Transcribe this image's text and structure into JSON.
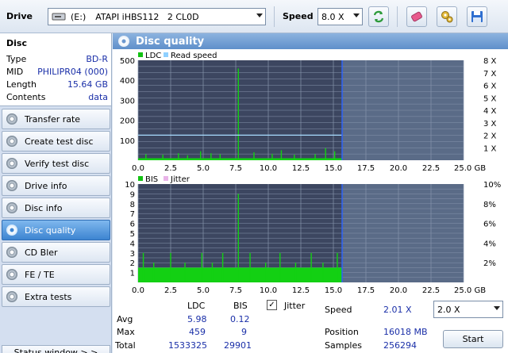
{
  "toolbar": {
    "drive_label": "Drive",
    "drive_letter": "(E:)",
    "drive_name": "ATAPI iHBS112   2 CL0D",
    "speed_label": "Speed",
    "speed_value": "8.0 X"
  },
  "disc": {
    "title": "Disc",
    "rows": [
      {
        "label": "Type",
        "value": "BD-R"
      },
      {
        "label": "MID",
        "value": "PHILIPR04 (000)"
      },
      {
        "label": "Length",
        "value": "15.64 GB"
      },
      {
        "label": "Contents",
        "value": "data"
      }
    ]
  },
  "nav": [
    {
      "label": "Transfer rate",
      "selected": false
    },
    {
      "label": "Create test disc",
      "selected": false
    },
    {
      "label": "Verify test disc",
      "selected": false
    },
    {
      "label": "Drive info",
      "selected": false
    },
    {
      "label": "Disc info",
      "selected": false
    },
    {
      "label": "Disc quality",
      "selected": true
    },
    {
      "label": "CD Bler",
      "selected": false
    },
    {
      "label": "FE / TE",
      "selected": false
    },
    {
      "label": "Extra tests",
      "selected": false
    }
  ],
  "status_window": "Status window > >",
  "panel_title": "Disc quality",
  "chart_data": [
    {
      "type": "bar",
      "legend": [
        "LDC",
        "Read speed"
      ],
      "x_ticks": [
        "0.0",
        "2.5",
        "5.0",
        "7.5",
        "10.0",
        "12.5",
        "15.0",
        "17.5",
        "20.0",
        "22.5",
        "25.0 GB"
      ],
      "xlim": [
        0,
        25
      ],
      "ylim": [
        0,
        500
      ],
      "y_ticks": [
        "100",
        "200",
        "300",
        "400",
        "500"
      ],
      "y2_ticks": [
        "1 X",
        "2 X",
        "3 X",
        "4 X",
        "5 X",
        "6 X",
        "7 X",
        "8 X"
      ],
      "y2lim": [
        0,
        8
      ],
      "data_end": 15.64,
      "ldc_base": 10,
      "ldc_spikes": [
        [
          0.6,
          30
        ],
        [
          1.9,
          28
        ],
        [
          3.1,
          35
        ],
        [
          3.8,
          25
        ],
        [
          4.8,
          45
        ],
        [
          5.6,
          35
        ],
        [
          6.3,
          30
        ],
        [
          7.7,
          459
        ],
        [
          8.9,
          40
        ],
        [
          10.3,
          32
        ],
        [
          11.0,
          50
        ],
        [
          12.0,
          28
        ],
        [
          13.6,
          30
        ],
        [
          14.4,
          60
        ],
        [
          15.1,
          45
        ]
      ],
      "read_speed_x": 2.01,
      "position_marker_gb": 15.64
    },
    {
      "type": "bar",
      "legend": [
        "BIS",
        "Jitter"
      ],
      "x_ticks": [
        "0.0",
        "2.5",
        "5.0",
        "7.5",
        "10.0",
        "12.5",
        "15.0",
        "17.5",
        "20.0",
        "22.5",
        "25.0 GB"
      ],
      "xlim": [
        0,
        25
      ],
      "ylim": [
        0,
        10
      ],
      "y_ticks": [
        "1",
        "2",
        "3",
        "4",
        "5",
        "6",
        "7",
        "8",
        "9",
        "10"
      ],
      "y2_ticks": [
        "2%",
        "4%",
        "6%",
        "8%",
        "10%"
      ],
      "y2lim": [
        0,
        10
      ],
      "data_end": 15.64,
      "bis_base": 1.5,
      "bis_spikes": [
        [
          0.4,
          3
        ],
        [
          1.2,
          2
        ],
        [
          2.5,
          3
        ],
        [
          3.6,
          2
        ],
        [
          4.9,
          3
        ],
        [
          5.7,
          2
        ],
        [
          6.5,
          3
        ],
        [
          7.7,
          9
        ],
        [
          8.6,
          3
        ],
        [
          9.8,
          2
        ],
        [
          10.9,
          3
        ],
        [
          12.1,
          2
        ],
        [
          13.3,
          3
        ],
        [
          14.2,
          2
        ],
        [
          15.3,
          3
        ]
      ]
    }
  ],
  "stats": {
    "col_ldc": "LDC",
    "col_bis": "BIS",
    "jitter_label": "Jitter",
    "jitter_checked": true,
    "rows": [
      {
        "label": "Avg",
        "ldc": "5.98",
        "bis": "0.12"
      },
      {
        "label": "Max",
        "ldc": "459",
        "bis": "9"
      },
      {
        "label": "Total",
        "ldc": "1533325",
        "bis": "29901"
      }
    ],
    "speed_label": "Speed",
    "speed_value": "2.01 X",
    "speed_select": "2.0 X",
    "position_label": "Position",
    "position_value": "16018 MB",
    "samples_label": "Samples",
    "samples_value": "256294",
    "start_label": "Start"
  }
}
